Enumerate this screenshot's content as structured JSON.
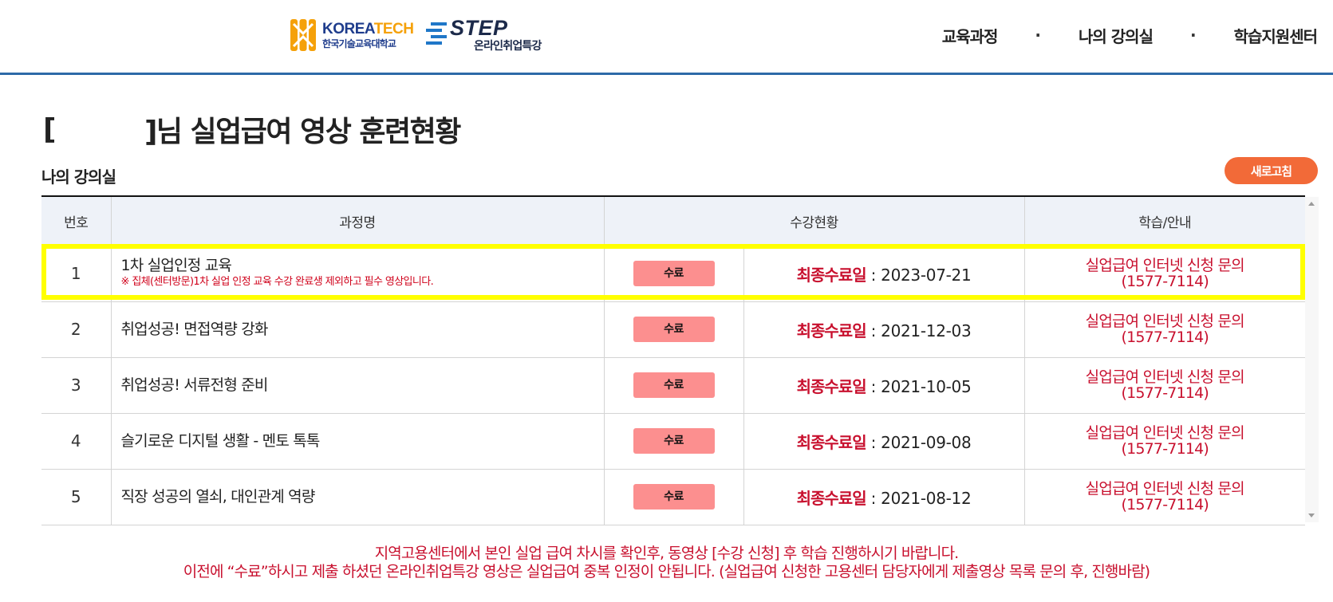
{
  "header": {
    "logo_koreatech": {
      "en_part1": "KOREA",
      "en_part2": "TECH",
      "ko": "한국기술교육대학교",
      "color_navy": "#1e3c8c",
      "color_orange": "#f5a10a"
    },
    "logo_step": {
      "en": "STEP",
      "ko": "온라인취업특강"
    },
    "nav": [
      {
        "label": "교육과정"
      },
      {
        "label": "나의 강의실"
      },
      {
        "label": "학습지원센터"
      }
    ],
    "nav_separator": "·"
  },
  "page": {
    "title_open": "[",
    "title_rest": "]님 실업급여 영상 훈련현황",
    "section_title": "나의 강의실",
    "refresh_label": "새로고침",
    "accent_color": "#f26a38",
    "highlight_color": "#ffff00"
  },
  "table": {
    "headers": {
      "number": "번호",
      "course": "과정명",
      "status": "수강현황",
      "guide": "학습/안내"
    },
    "date_label": "최종수료일",
    "date_sep": " : ",
    "rows": [
      {
        "number": "1",
        "course": "1차 실업인정 교육",
        "note": "※ 집체(센터방문)1차 실업 인정 교육 수강 완료생 제외하고 필수 영상입니다.",
        "status": "수료",
        "date": "2023-07-21",
        "guide_line1": "실업급여 인터넷 신청 문의",
        "guide_line2": "(1577-7114)"
      },
      {
        "number": "2",
        "course": "취업성공! 면접역량 강화",
        "note": "",
        "status": "수료",
        "date": "2021-12-03",
        "guide_line1": "실업급여 인터넷 신청 문의",
        "guide_line2": "(1577-7114)"
      },
      {
        "number": "3",
        "course": "취업성공! 서류전형 준비",
        "note": "",
        "status": "수료",
        "date": "2021-10-05",
        "guide_line1": "실업급여 인터넷 신청 문의",
        "guide_line2": "(1577-7114)"
      },
      {
        "number": "4",
        "course": "슬기로운 디지털 생활 - 멘토 톡톡",
        "note": "",
        "status": "수료",
        "date": "2021-09-08",
        "guide_line1": "실업급여 인터넷 신청 문의",
        "guide_line2": "(1577-7114)"
      },
      {
        "number": "5",
        "course": "직장 성공의 열쇠, 대인관계 역량",
        "note": "",
        "status": "수료",
        "date": "2021-08-12",
        "guide_line1": "실업급여 인터넷 신청 문의",
        "guide_line2": "(1577-7114)"
      }
    ]
  },
  "notice": {
    "line1": "지역고용센터에서 본인 실업 급여 차시를 확인후, 동영상 [수강 신청] 후 학습 진행하시기 바랍니다.",
    "line2": "이전에 “수료”하시고 제출 하셨던 온라인취업특강 영상은 실업급여 중복 인정이 안됩니다. (실업급여 신청한 고용센터 담당자에게 제출영상 목록 문의 후, 진행바람)"
  }
}
